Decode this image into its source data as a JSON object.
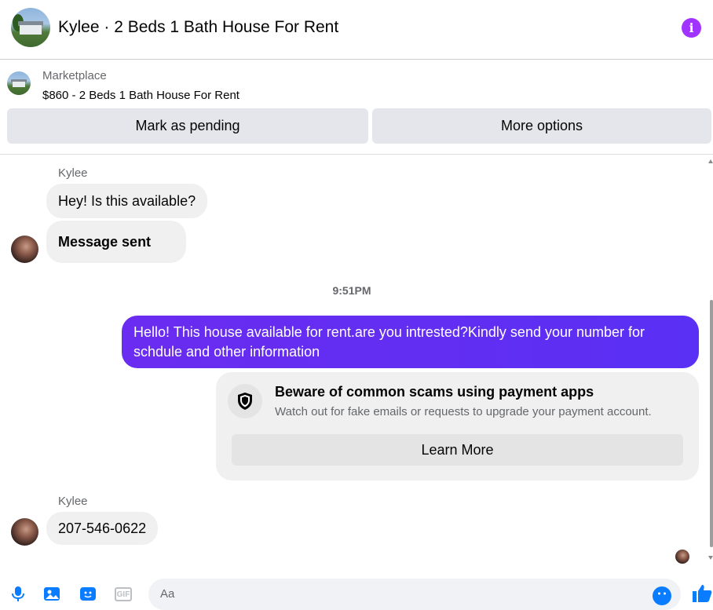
{
  "header": {
    "title": "Kylee · 2 Beds 1 Bath House For Rent",
    "info_icon": "info-icon",
    "accent_color": "#a033ff"
  },
  "marketplace": {
    "label": "Marketplace",
    "listing": "$860 - 2 Beds 1 Bath House For Rent",
    "buttons": {
      "mark_pending": "Mark as pending",
      "more_options": "More options"
    }
  },
  "conversation": {
    "incoming_1": {
      "sender": "Kylee",
      "messages": [
        "Hey! Is this available?",
        "Message sent"
      ]
    },
    "timestamp": "9:51PM",
    "outgoing": {
      "text": "Hello! This house available for rent.are you intrested?Kindly send your number for schdule and other information",
      "color": "#5b2bf2"
    },
    "scam_warning": {
      "icon": "shield-icon",
      "title": "Beware of common scams using payment apps",
      "body": "Watch out for fake emails or requests to upgrade your payment account.",
      "button": "Learn More"
    },
    "incoming_2": {
      "sender": "Kylee",
      "message": "207-546-0622"
    }
  },
  "composer": {
    "placeholder": "Aa",
    "icons": [
      "microphone-icon",
      "photo-icon",
      "sticker-icon",
      "gif-icon",
      "emoji-icon",
      "like-icon"
    ],
    "gif_label": "GIF",
    "icon_color": "#0a7cff"
  }
}
